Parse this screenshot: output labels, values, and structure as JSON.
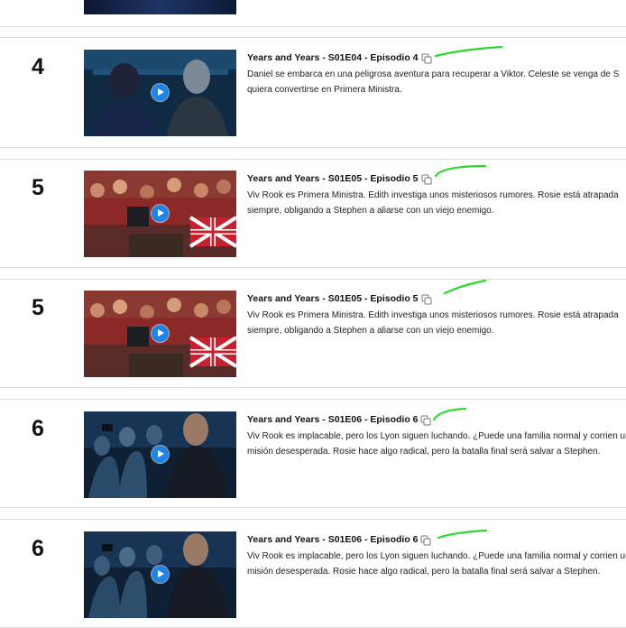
{
  "episodes": [
    {
      "number": "4",
      "title": "Years and Years - S01E04 - Episodio 4",
      "description": "Daniel se embarca en una peligrosa aventura para recuperar a Viktor. Celeste se venga de S quiera convertirse en Primera Ministra."
    },
    {
      "number": "5",
      "title": "Years and Years - S01E05 - Episodio 5",
      "description": "Viv Rook es Primera Ministra. Edith investiga unos misteriosos rumores. Rosie está atrapada siempre, obligando a Stephen a aliarse con un viejo enemigo."
    },
    {
      "number": "5",
      "title": "Years and Years - S01E05 - Episodio 5",
      "description": "Viv Rook es Primera Ministra. Edith investiga unos misteriosos rumores. Rosie está atrapada siempre, obligando a Stephen a aliarse con un viejo enemigo."
    },
    {
      "number": "6",
      "title": "Years and Years - S01E06 - Episodio 6",
      "description": "Viv Rook es implacable, pero los Lyon siguen luchando. ¿Puede una familia normal y corrien una misión desesperada. Rosie hace algo radical, pero la batalla final será salvar a Stephen."
    },
    {
      "number": "6",
      "title": "Years and Years - S01E06 - Episodio 6",
      "description": "Viv Rook es implacable, pero los Lyon siguen luchando. ¿Puede una familia normal y corrien una misión desesperada. Rosie hace algo radical, pero la batalla final será salvar a Stephen."
    }
  ],
  "icons": {
    "copy": "copy-icon",
    "play": "play-icon"
  },
  "colors": {
    "annotation": "#2dd62d",
    "play_button": "#1f84e6",
    "divider": "#dedede"
  }
}
